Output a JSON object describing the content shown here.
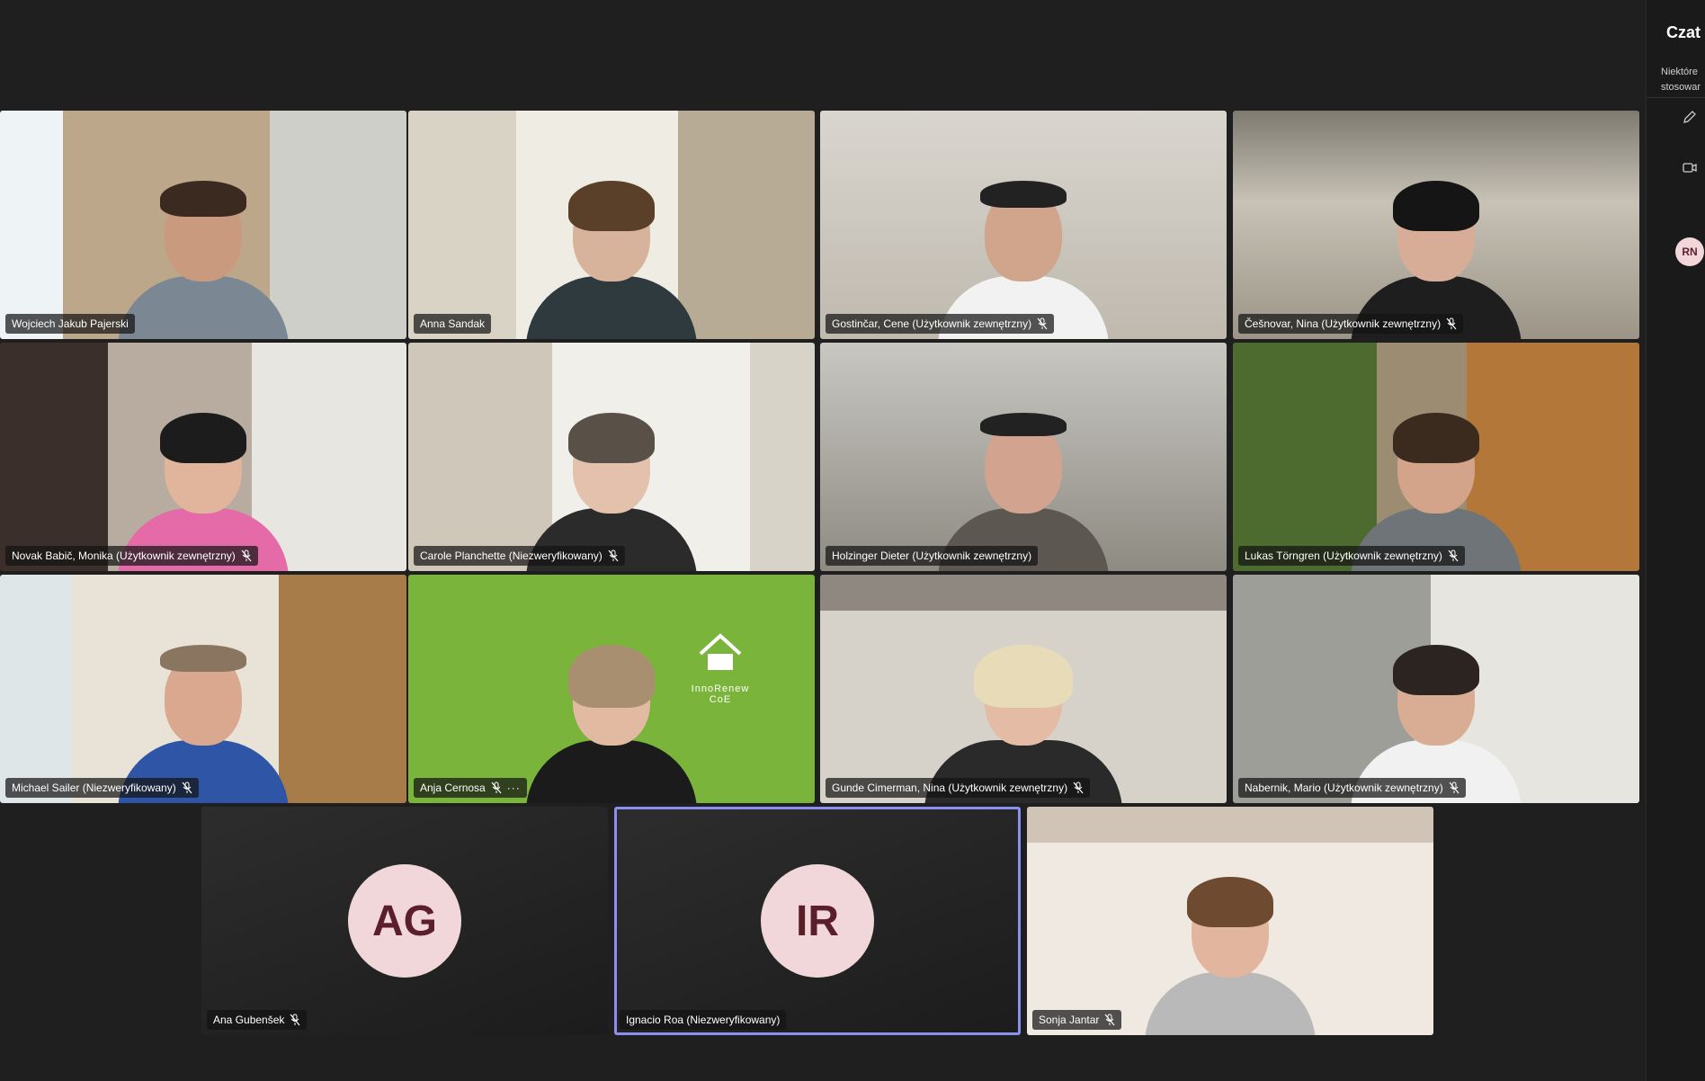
{
  "colors": {
    "accent": "#7f85f5",
    "background": "#1f1f1f",
    "avatar_bg": "#f1d7d9",
    "avatar_fg": "#5a1f2b"
  },
  "participants": [
    {
      "name": "Wojciech Jakub Pajerski",
      "muted": false
    },
    {
      "name": "Anna Sandak",
      "muted": false
    },
    {
      "name": "Gostinčar, Cene (Użytkownik zewnętrzny)",
      "muted": true
    },
    {
      "name": "Češnovar, Nina (Użytkownik zewnętrzny)",
      "muted": true
    },
    {
      "name": "Novak Babič, Monika (Użytkownik zewnętrzny)",
      "muted": true
    },
    {
      "name": "Carole Planchette (Niezweryfikowany)",
      "muted": true
    },
    {
      "name": "Holzinger Dieter (Użytkownik zewnętrzny)",
      "muted": false
    },
    {
      "name": "Lukas Törngren (Użytkownik zewnętrzny)",
      "muted": true
    },
    {
      "name": "Michael Sailer (Niezweryfikowany)",
      "muted": true
    },
    {
      "name": "Anja Cernosa",
      "muted": true
    },
    {
      "name": "Gunde Cimerman, Nina (Użytkownik zewnętrzny)",
      "muted": true
    },
    {
      "name": "Nabernik, Mario (Użytkownik zewnętrzny)",
      "muted": true
    },
    {
      "name": "Ana Gubenšek",
      "muted": true,
      "initials": "AG"
    },
    {
      "name": "Ignacio Roa (Niezweryfikowany)",
      "muted": false,
      "initials": "IR"
    },
    {
      "name": "Sonja Jantar",
      "muted": true
    }
  ],
  "tile_logo": {
    "text": "InnoRenew CoE"
  },
  "side_panel": {
    "title": "Czat s",
    "note_line1": "Niektóre",
    "note_line2": "stosowar",
    "avatar_initials": "RN",
    "icons": [
      "edit-icon",
      "video-icon"
    ]
  }
}
